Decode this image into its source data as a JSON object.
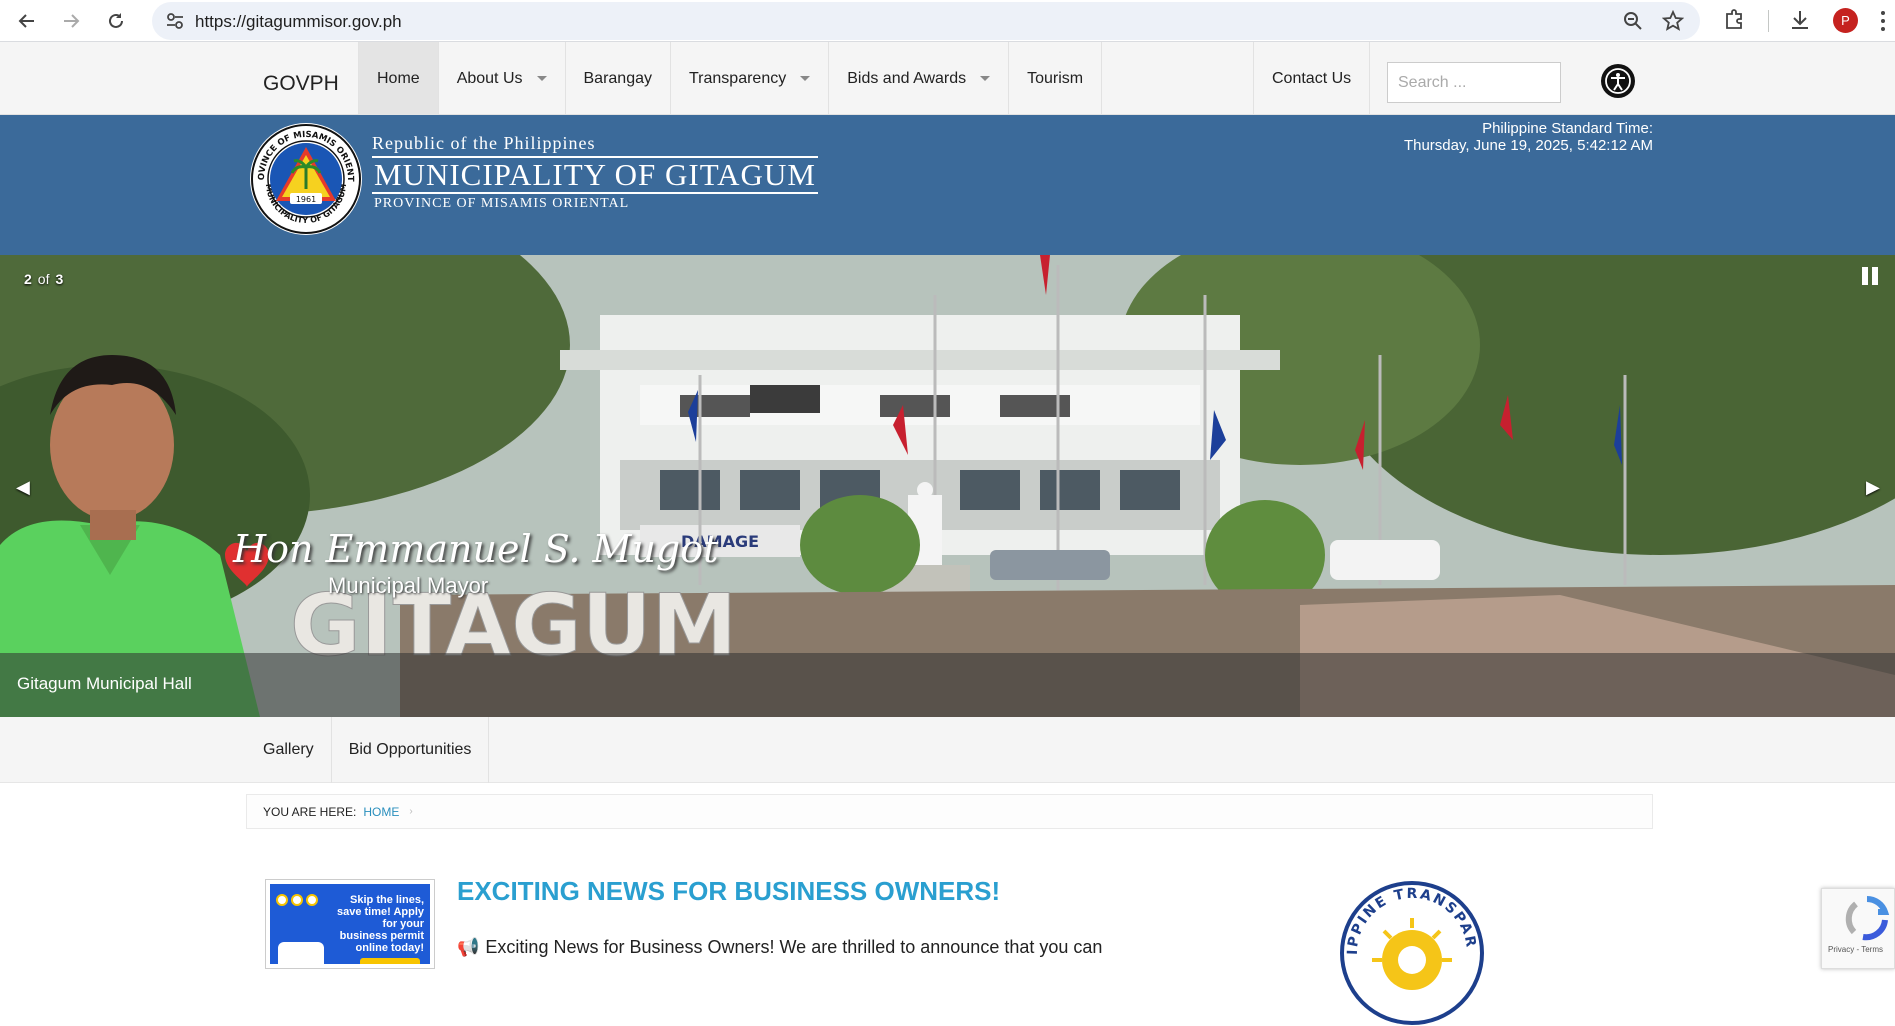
{
  "browser": {
    "url": "https://gitagummisor.gov.ph",
    "profile_initial": "P"
  },
  "topnav": {
    "brand": "GOVPH",
    "items": [
      {
        "label": "Home",
        "active": true,
        "dropdown": false
      },
      {
        "label": "About Us",
        "active": false,
        "dropdown": true
      },
      {
        "label": "Barangay",
        "active": false,
        "dropdown": false
      },
      {
        "label": "Transparency",
        "active": false,
        "dropdown": true
      },
      {
        "label": "Bids and Awards",
        "active": false,
        "dropdown": true
      },
      {
        "label": "Tourism",
        "active": false,
        "dropdown": false
      }
    ],
    "contact": "Contact Us",
    "search_placeholder": "Search ..."
  },
  "banner": {
    "line_top": "Republic of the Philippines",
    "line_main": "Municipality of Gitagum",
    "line_bottom": "Province of Misamis Oriental",
    "seal_year": "1961",
    "seal_text_top": "PROVINCE OF MISAMIS ORIENTAL",
    "seal_text_bottom": "MUNICIPALITY OF GITAGUM",
    "clock_label": "Philippine Standard Time:",
    "clock_value": "Thursday, June 19, 2025, 5:42:12 AM"
  },
  "slider": {
    "current": "2",
    "of": "of",
    "total": "3",
    "caption": "Gitagum Municipal Hall",
    "mayor_name": "Hon Emmanuel S. Mugot",
    "mayor_title": "Municipal Mayor",
    "sign_text": "GITAGUM",
    "banner_text": "DAMAGE"
  },
  "subnav": {
    "items": [
      "Gallery",
      "Bid Opportunities"
    ]
  },
  "breadcrumb": {
    "label": "YOU ARE HERE:",
    "home": "HOME",
    "separator": "›"
  },
  "article": {
    "thumb_text": "Skip the lines, save time! Apply for your business permit online today!",
    "headline": "EXCITING NEWS FOR BUSINESS OWNERS!",
    "lead_icon": "megaphone-icon",
    "lead": "Exciting News for Business Owners! We are thrilled to announce that you can"
  },
  "transparency_seal": {
    "text": "PHILIPPINE TRANSPARENCY"
  },
  "recaptcha": {
    "privacy": "Privacy",
    "terms": "Terms",
    "separator": "-"
  },
  "colors": {
    "banner_blue": "#3b6a9a",
    "link_blue": "#2a9fd0",
    "nav_bg": "#f5f5f5"
  }
}
